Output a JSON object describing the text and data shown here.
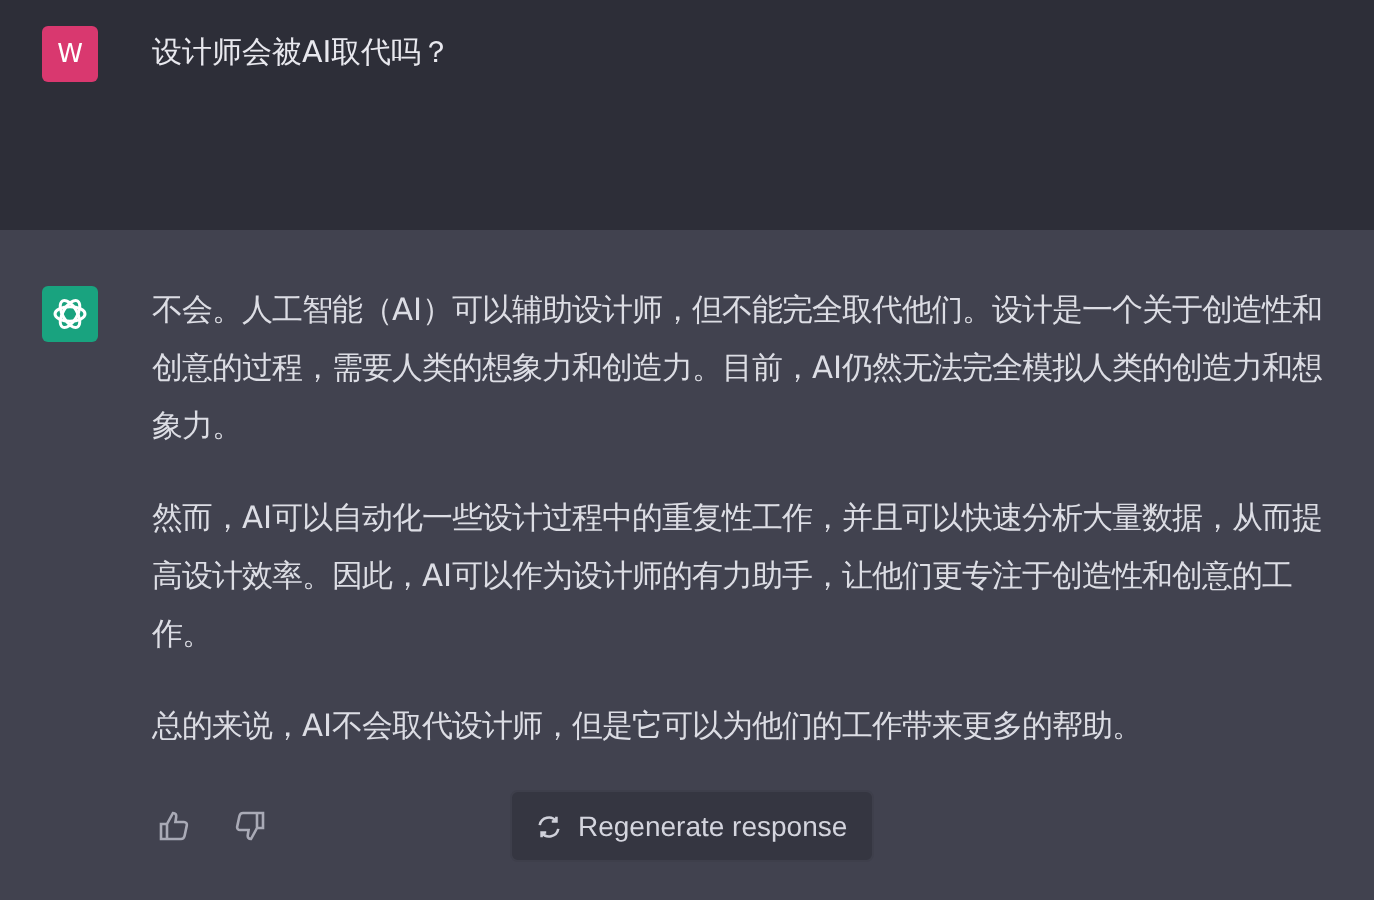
{
  "question": {
    "avatar": "W",
    "text": "设计师会被AI取代吗？"
  },
  "answer": {
    "paragraphs": [
      "不会。人工智能（AI）可以辅助设计师，但不能完全取代他们。设计是一个关于创造性和创意的过程，需要人类的想象力和创造力。目前，AI仍然无法完全模拟人类的创造力和想象力。",
      "然而，AI可以自动化一些设计过程中的重复性工作，并且可以快速分析大量数据，从而提高设计效率。因此，AI可以作为设计师的有力助手，让他们更专注于创造性和创意的工作。",
      "总的来说，AI不会取代设计师，但是它可以为他们的工作带来更多的帮助。"
    ]
  },
  "regenerate_button": "Regenerate response"
}
